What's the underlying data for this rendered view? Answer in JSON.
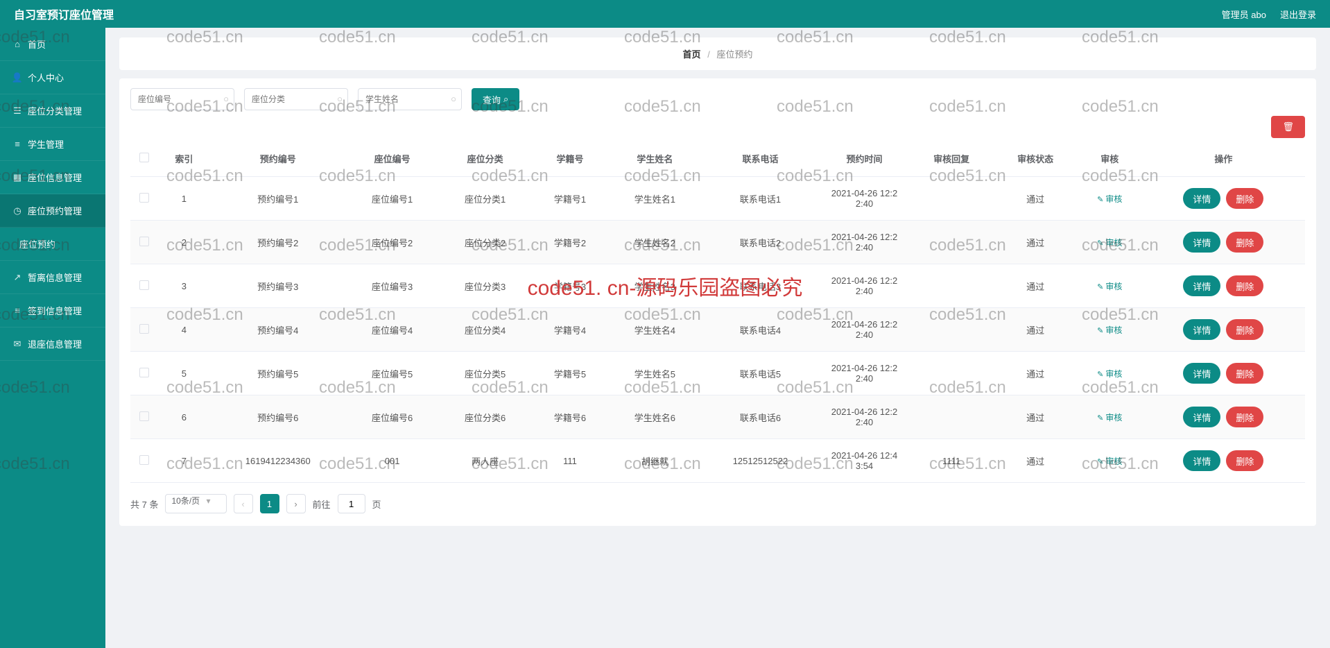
{
  "header": {
    "title": "自习室预订座位管理",
    "admin_label": "管理员 abo",
    "logout_label": "退出登录"
  },
  "sidebar": {
    "items": [
      {
        "icon": "home",
        "label": "首页"
      },
      {
        "icon": "user",
        "label": "个人中心"
      },
      {
        "icon": "category",
        "label": "座位分类管理"
      },
      {
        "icon": "student",
        "label": "学生管理"
      },
      {
        "icon": "seat",
        "label": "座位信息管理"
      },
      {
        "icon": "reserve",
        "label": "座位预约管理"
      }
    ],
    "subitem": "座位预约",
    "items_after": [
      {
        "icon": "leave",
        "label": "暂离信息管理"
      },
      {
        "icon": "signin",
        "label": "签到信息管理"
      },
      {
        "icon": "return",
        "label": "退座信息管理"
      }
    ]
  },
  "breadcrumb": {
    "home": "首页",
    "current": "座位预约"
  },
  "search": {
    "seat_no_placeholder": "座位编号",
    "seat_type_placeholder": "座位分类",
    "student_name_placeholder": "学生姓名",
    "query_label": "查询"
  },
  "table": {
    "columns": [
      "",
      "索引",
      "预约编号",
      "座位编号",
      "座位分类",
      "学籍号",
      "学生姓名",
      "联系电话",
      "预约时间",
      "审核回复",
      "审核状态",
      "审核",
      "操作"
    ],
    "rows": [
      {
        "idx": "1",
        "reserve_no": "预约编号1",
        "seat_no": "座位编号1",
        "seat_type": "座位分类1",
        "student_id": "学籍号1",
        "student_name": "学生姓名1",
        "phone": "联系电话1",
        "time": "2021-04-26 12:22:40",
        "reply": "",
        "status": "通过",
        "audit": "审核"
      },
      {
        "idx": "2",
        "reserve_no": "预约编号2",
        "seat_no": "座位编号2",
        "seat_type": "座位分类2",
        "student_id": "学籍号2",
        "student_name": "学生姓名2",
        "phone": "联系电话2",
        "time": "2021-04-26 12:22:40",
        "reply": "",
        "status": "通过",
        "audit": "审核"
      },
      {
        "idx": "3",
        "reserve_no": "预约编号3",
        "seat_no": "座位编号3",
        "seat_type": "座位分类3",
        "student_id": "学籍号3",
        "student_name": "学生姓名3",
        "phone": "联系电话3",
        "time": "2021-04-26 12:22:40",
        "reply": "",
        "status": "通过",
        "audit": "审核"
      },
      {
        "idx": "4",
        "reserve_no": "预约编号4",
        "seat_no": "座位编号4",
        "seat_type": "座位分类4",
        "student_id": "学籍号4",
        "student_name": "学生姓名4",
        "phone": "联系电话4",
        "time": "2021-04-26 12:22:40",
        "reply": "",
        "status": "通过",
        "audit": "审核"
      },
      {
        "idx": "5",
        "reserve_no": "预约编号5",
        "seat_no": "座位编号5",
        "seat_type": "座位分类5",
        "student_id": "学籍号5",
        "student_name": "学生姓名5",
        "phone": "联系电话5",
        "time": "2021-04-26 12:22:40",
        "reply": "",
        "status": "通过",
        "audit": "审核"
      },
      {
        "idx": "6",
        "reserve_no": "预约编号6",
        "seat_no": "座位编号6",
        "seat_type": "座位分类6",
        "student_id": "学籍号6",
        "student_name": "学生姓名6",
        "phone": "联系电话6",
        "time": "2021-04-26 12:22:40",
        "reply": "",
        "status": "通过",
        "audit": "审核"
      },
      {
        "idx": "7",
        "reserve_no": "1619412234360",
        "seat_no": "001",
        "seat_type": "两人座",
        "student_id": "111",
        "student_name": "胡继就",
        "phone": "12512512522",
        "time": "2021-04-26 12:43:54",
        "reply": "1111",
        "status": "通过",
        "audit": "审核"
      }
    ],
    "detail_label": "详情",
    "delete_label": "删除"
  },
  "pagination": {
    "total_label": "共 7 条",
    "page_size_label": "10条/页",
    "current_page": "1",
    "goto_prefix": "前往",
    "goto_value": "1",
    "goto_suffix": "页"
  },
  "watermark": {
    "text": "code51.cn",
    "center": "code51. cn-源码乐园盗图必究"
  }
}
